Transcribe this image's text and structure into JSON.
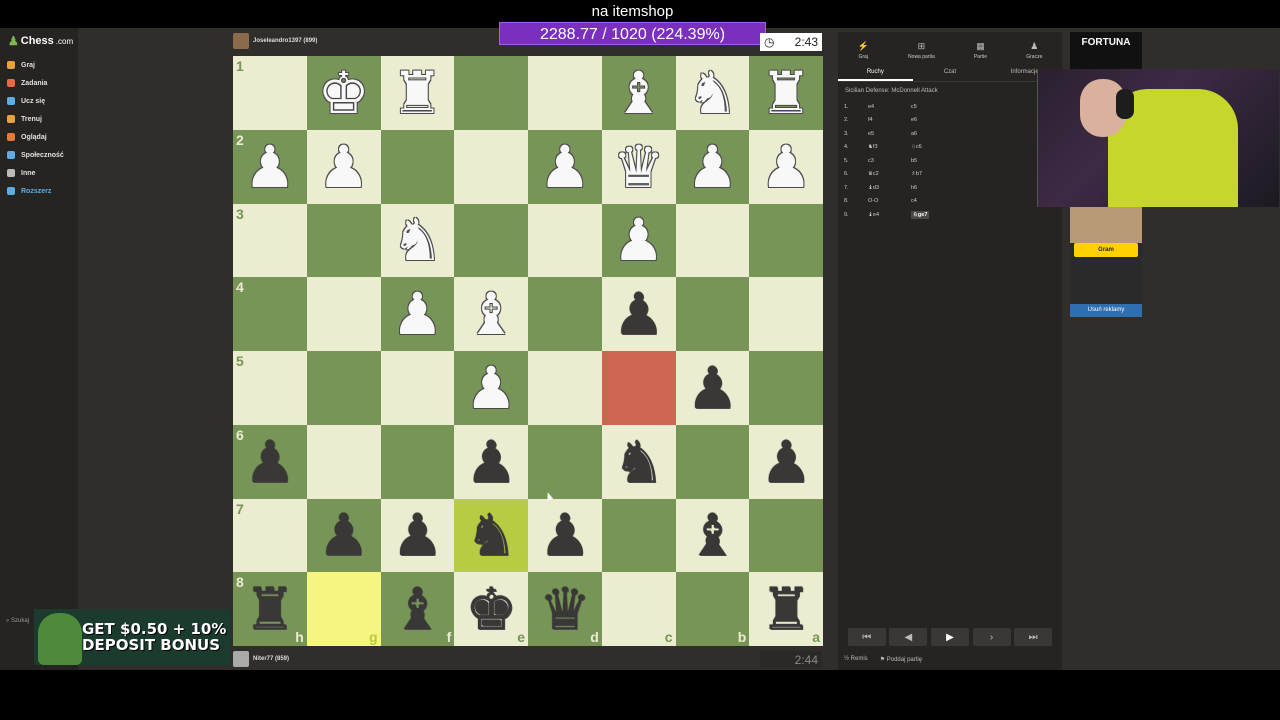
{
  "overlay": {
    "title": "na itemshop",
    "counter": "2288.77 / 1020 (224.39%)"
  },
  "brand": {
    "name": "Chess",
    "tld": ".com"
  },
  "sidebar": {
    "items": [
      {
        "label": "Graj",
        "color": "#e8a33d"
      },
      {
        "label": "Zadania",
        "color": "#e86a3d"
      },
      {
        "label": "Ucz się",
        "color": "#5dade2"
      },
      {
        "label": "Trenuj",
        "color": "#e8a33d"
      },
      {
        "label": "Oglądaj",
        "color": "#e07b3a"
      },
      {
        "label": "Społeczność",
        "color": "#5dade2"
      },
      {
        "label": "Inne",
        "color": "#bbbbbb"
      },
      {
        "label": "Rozszerz",
        "color": "#5dade2"
      }
    ],
    "search_label": "Szukaj"
  },
  "players": {
    "top": {
      "name": "Joseleandro1397 (899)",
      "clock": "2:43"
    },
    "bottom": {
      "name": "Niter77 (859)",
      "clock": "2:44"
    }
  },
  "board": {
    "ranks": [
      "1",
      "2",
      "3",
      "4",
      "5",
      "6",
      "7",
      "8"
    ],
    "files": [
      "h",
      "g",
      "f",
      "e",
      "d",
      "c",
      "b",
      "a"
    ],
    "pieces": [
      [
        "",
        "wK",
        "wR",
        "",
        "",
        "wB",
        "wN",
        "wR"
      ],
      [
        "wP",
        "wP",
        "",
        "",
        "wP",
        "wQ",
        "wP",
        "wP"
      ],
      [
        "",
        "",
        "wN",
        "",
        "",
        "wP",
        "",
        ""
      ],
      [
        "",
        "",
        "wP",
        "wB",
        "",
        "bP",
        "",
        ""
      ],
      [
        "",
        "",
        "",
        "wP",
        "",
        "",
        "bP",
        ""
      ],
      [
        "bP",
        "",
        "",
        "bP",
        "",
        "bN",
        "",
        "bP"
      ],
      [
        "",
        "bP",
        "bP",
        "bN",
        "bP",
        "",
        "bB",
        ""
      ],
      [
        "bR",
        "",
        "bB",
        "bK",
        "bQ",
        "",
        "",
        "bR"
      ]
    ],
    "highlights": {
      "6-3": "hl-yellow-dark",
      "7-1": "hl-yellow-light",
      "4-5": "hl-red"
    }
  },
  "panel": {
    "top_tabs": [
      {
        "icon": "bolt-icon",
        "glyph": "⚡",
        "label": "Graj"
      },
      {
        "icon": "plus-icon",
        "glyph": "⊞",
        "label": "Nowa partia"
      },
      {
        "icon": "grid-icon",
        "glyph": "▦",
        "label": "Partie"
      },
      {
        "icon": "users-icon",
        "glyph": "♟",
        "label": "Gracze"
      }
    ],
    "sub_tabs": [
      "Ruchy",
      "Czat",
      "Informacje"
    ],
    "opening": "Sicilian Defense: McDonnell Attack",
    "moves": [
      {
        "n": "1.",
        "w": "e4",
        "b": "c5"
      },
      {
        "n": "2.",
        "w": "f4",
        "b": "e6"
      },
      {
        "n": "3.",
        "w": "e5",
        "b": "a6"
      },
      {
        "n": "4.",
        "w": "♞f3",
        "b": "♘c6"
      },
      {
        "n": "5.",
        "w": "c3",
        "b": "b5"
      },
      {
        "n": "6.",
        "w": "♛c2",
        "b": "♗b7"
      },
      {
        "n": "7.",
        "w": "♝d3",
        "b": "h6"
      },
      {
        "n": "8.",
        "w": "O-O",
        "b": "c4"
      },
      {
        "n": "9.",
        "w": "♝e4",
        "b": "♘ge7"
      }
    ],
    "footer": {
      "draw": "Remis",
      "resign": "Poddaj partię"
    }
  },
  "ads": {
    "brand": "FORTUNA",
    "play_button": "Gram",
    "remove_ads": "Usuń reklamy",
    "casino_text": "GET $0.50 + 10% DEPOSIT BONUS"
  }
}
